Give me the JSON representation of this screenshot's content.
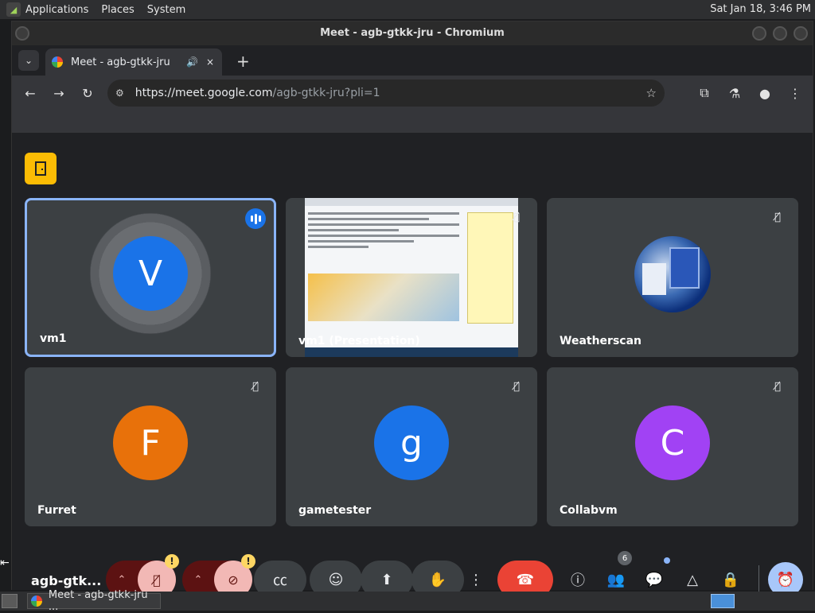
{
  "top_panel": {
    "menus": [
      "Applications",
      "Places",
      "System"
    ],
    "clock": "Sat Jan 18,  3:46 PM"
  },
  "window": {
    "title": "Meet - agb-gtkk-jru - Chromium"
  },
  "tabs": [
    {
      "label": "Meet - agb-gtkk-jru",
      "audio_icon": "speaker-icon",
      "close": "×"
    }
  ],
  "new_tab_label": "+",
  "address_bar": {
    "url_host": "https://meet.google.com",
    "url_rest": "/agb-gtkk-jru?pli=1"
  },
  "meet": {
    "meeting_code": "agb-gtk...",
    "participant_count": "6",
    "tiles": [
      {
        "name": "vm1",
        "initial": "V",
        "color": "#1a73e8",
        "speaking": true,
        "muted": false
      },
      {
        "name": "vm1 (Presentation)",
        "initial": "",
        "color": "",
        "speaking": false,
        "muted": true
      },
      {
        "name": "Weatherscan",
        "initial": "",
        "color": "",
        "speaking": false,
        "muted": true
      },
      {
        "name": "Furret",
        "initial": "F",
        "color": "#e8710a",
        "speaking": false,
        "muted": true
      },
      {
        "name": "gametester",
        "initial": "g",
        "color": "#1a73e8",
        "speaking": false,
        "muted": true
      },
      {
        "name": "Collabvm",
        "initial": "C",
        "color": "#a142f4",
        "speaking": false,
        "muted": true
      }
    ],
    "warn_badge": "!"
  },
  "taskbar": {
    "task_label": "Meet - agb-gtkk-jru ..."
  },
  "colors": {
    "accent_blue": "#8ab4f8",
    "end_call_red": "#ea4335",
    "warning_yellow": "#fdd663",
    "door_yellow": "#fbbc04"
  }
}
